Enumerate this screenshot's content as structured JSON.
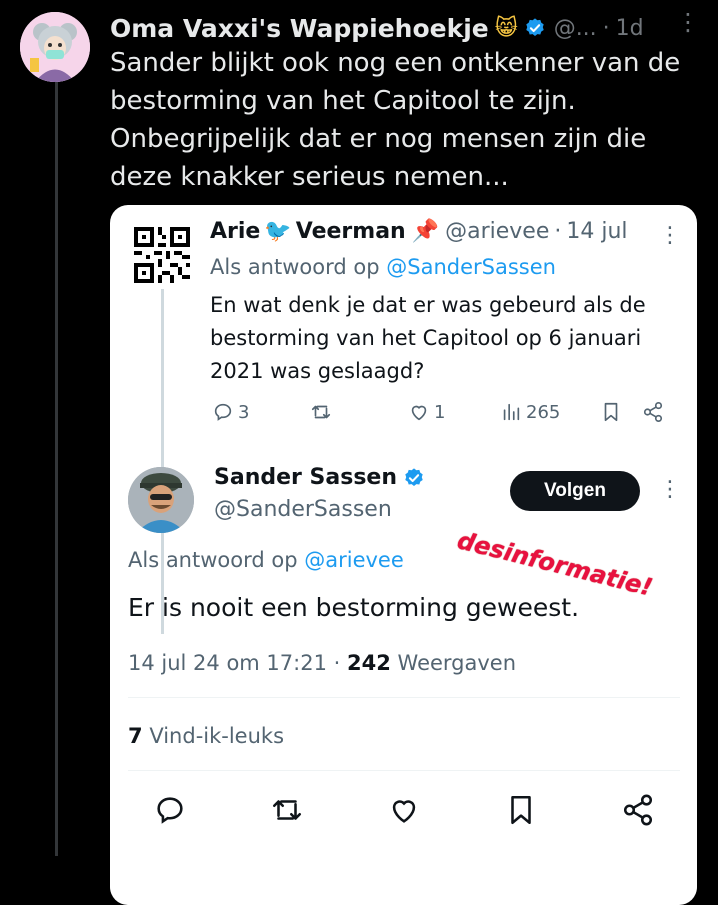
{
  "tweet": {
    "author_name": "Oma Vaxxi's Wappiehoekje",
    "author_emoji": "😸",
    "handle": "@...",
    "separator": "·",
    "time": "1d",
    "more": "⋮",
    "text": "Sander blijkt ook nog een ontkenner van de bestorming van het Capitool te zijn. Onbegrijpelijk dat er nog mensen zijn die deze knakker serieus nemen..."
  },
  "quoted": {
    "author_first": "Arie",
    "author_emoji1": "🐦",
    "author_last": "Veerman",
    "author_emoji2": "📌",
    "handle": "@arievee",
    "separator": "·",
    "date": "14 jul",
    "more": "⋮",
    "reply_prefix": "Als antwoord op",
    "reply_handle": "@SanderSassen",
    "text": "En wat denk je dat er was gebeurd als de bestorming van het Capitool op 6 januari 2021 was geslaagd?",
    "replies": "3",
    "retweets": "",
    "likes": "1",
    "views": "265"
  },
  "reply": {
    "author_name": "Sander Sassen",
    "handle": "@SanderSassen",
    "follow_label": "Volgen",
    "more": "⋮",
    "stamp": "desinformatie!",
    "reply_prefix": "Als antwoord op",
    "reply_handle": "@arievee",
    "text": "Er is nooit een bestorming geweest.",
    "timestamp": "14 jul 24 om 17:21",
    "separator": "·",
    "views_count": "242",
    "views_label": "Weergaven",
    "likes_count": "7",
    "likes_label": "Vind-ik-leuks"
  },
  "colors": {
    "accent": "#1d9bf0",
    "verified": "#1d9bf0",
    "stamp": "#e8113f",
    "background": "#000000",
    "card": "#ffffff"
  },
  "icons": [
    "reply-icon",
    "retweet-icon",
    "like-icon",
    "views-icon",
    "bookmark-icon",
    "share-icon",
    "verified-icon",
    "more-icon"
  ]
}
